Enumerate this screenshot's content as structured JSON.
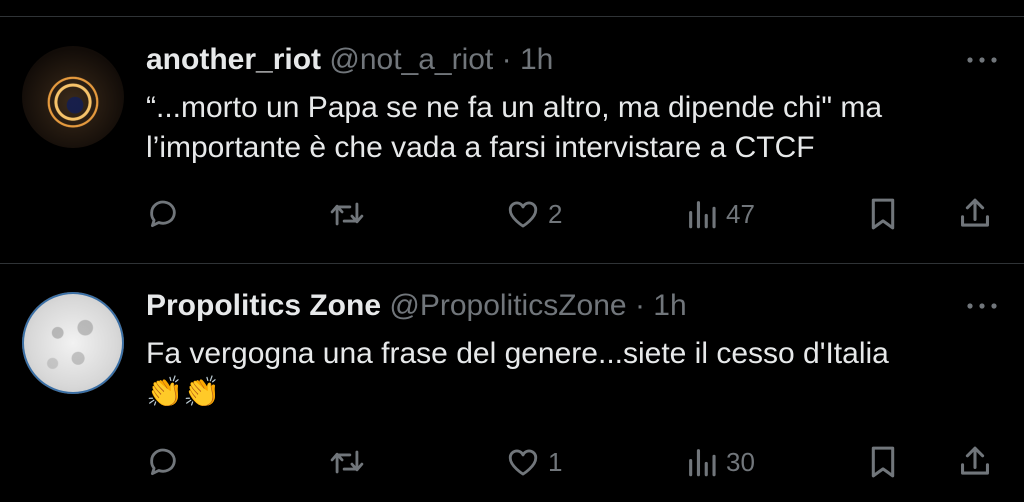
{
  "colors": {
    "background": "#000000",
    "text_primary": "#e7e9ea",
    "text_secondary": "#71767b",
    "divider": "#2f3336"
  },
  "tweets": [
    {
      "name": "another_riot",
      "handle": "@not_a_riot",
      "separator": "·",
      "time": "1h",
      "text_lines": [
        "“...morto un Papa se ne fa un altro, ma dipende chi\" ma",
        "l’importante è che vada a farsi intervistare a CTCF"
      ],
      "emojis": "",
      "reply_icon": "reply-icon",
      "retweet_icon": "retweet-icon",
      "like_icon": "heart-icon",
      "likes": "2",
      "views_icon": "views-icon",
      "views": "47",
      "bookmark_icon": "bookmark-icon",
      "share_icon": "share-icon"
    },
    {
      "name": "Propolitics Zone",
      "handle": "@PropoliticsZone",
      "separator": "·",
      "time": "1h",
      "text_lines": [
        "Fa vergogna una frase del genere...siete il cesso d'Italia"
      ],
      "emojis": "👏👏",
      "reply_icon": "reply-icon",
      "retweet_icon": "retweet-icon",
      "like_icon": "heart-icon",
      "likes": "1",
      "views_icon": "views-icon",
      "views": "30",
      "bookmark_icon": "bookmark-icon",
      "share_icon": "share-icon"
    }
  ]
}
